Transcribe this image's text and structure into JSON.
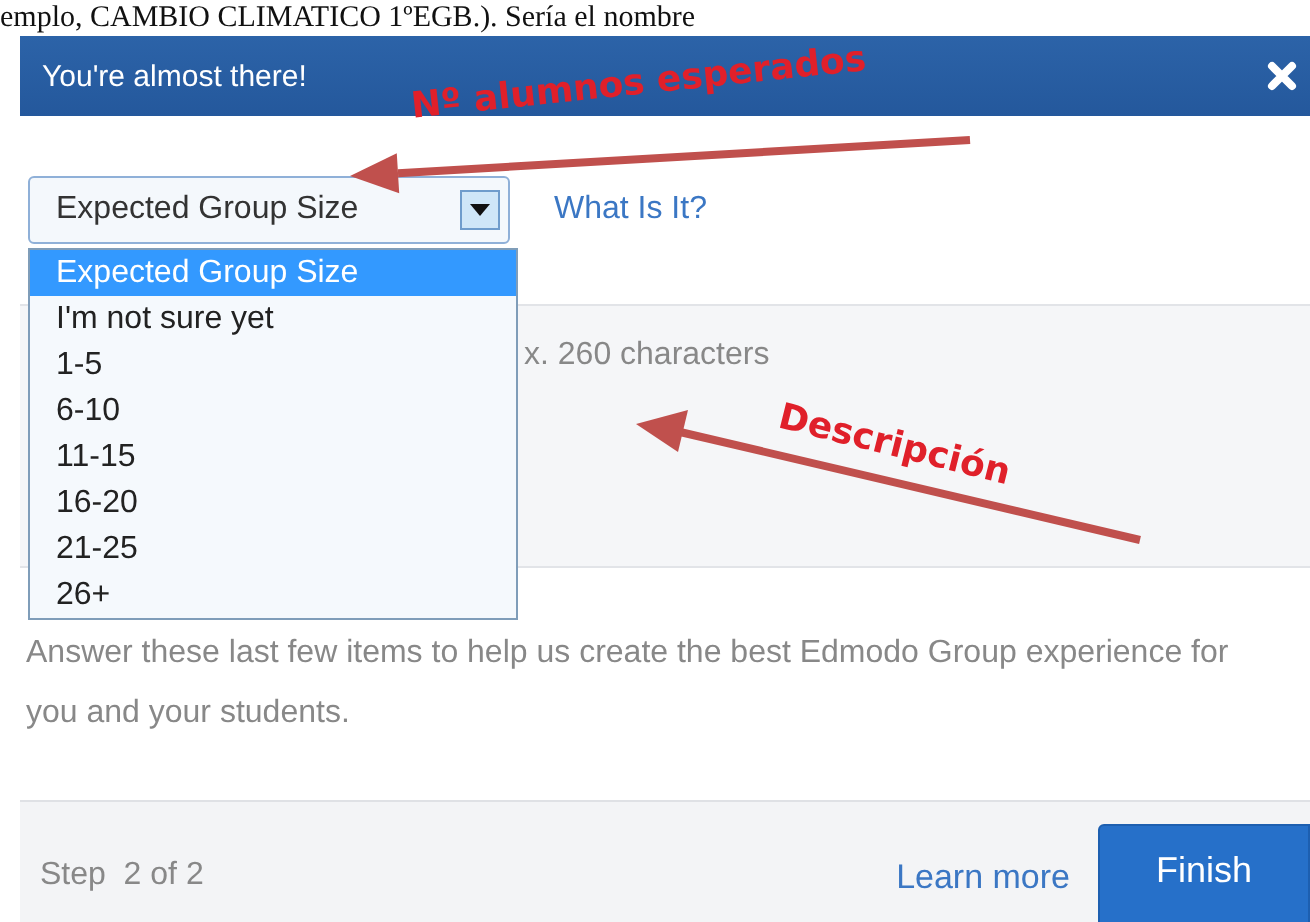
{
  "document_text": "emplo, CAMBIO CLIMATICO 1ºEGB.). Sería el nombre",
  "dialog": {
    "title": "You're almost there!",
    "group_size_select": {
      "value": "Expected Group Size",
      "open": true,
      "options": [
        {
          "label": "Expected Group Size",
          "selected": true
        },
        {
          "label": "I'm not sure yet",
          "selected": false
        },
        {
          "label": "1-5",
          "selected": false
        },
        {
          "label": "6-10",
          "selected": false
        },
        {
          "label": "11-15",
          "selected": false
        },
        {
          "label": "16-20",
          "selected": false
        },
        {
          "label": "21-25",
          "selected": false
        },
        {
          "label": "26+",
          "selected": false
        }
      ]
    },
    "help_link": "What Is It?",
    "description": {
      "placeholder": "x. 260 characters"
    },
    "intro": "Answer these last few items to help us create the best Edmodo Group experience for you and your students.",
    "footer": {
      "step": "Step  2 of 2",
      "learn_more": "Learn more",
      "finish": "Finish"
    }
  },
  "annotations": [
    {
      "text": "Nº alumnos esperados",
      "kind": "group-size"
    },
    {
      "text": "Descripción",
      "kind": "description"
    }
  ]
}
